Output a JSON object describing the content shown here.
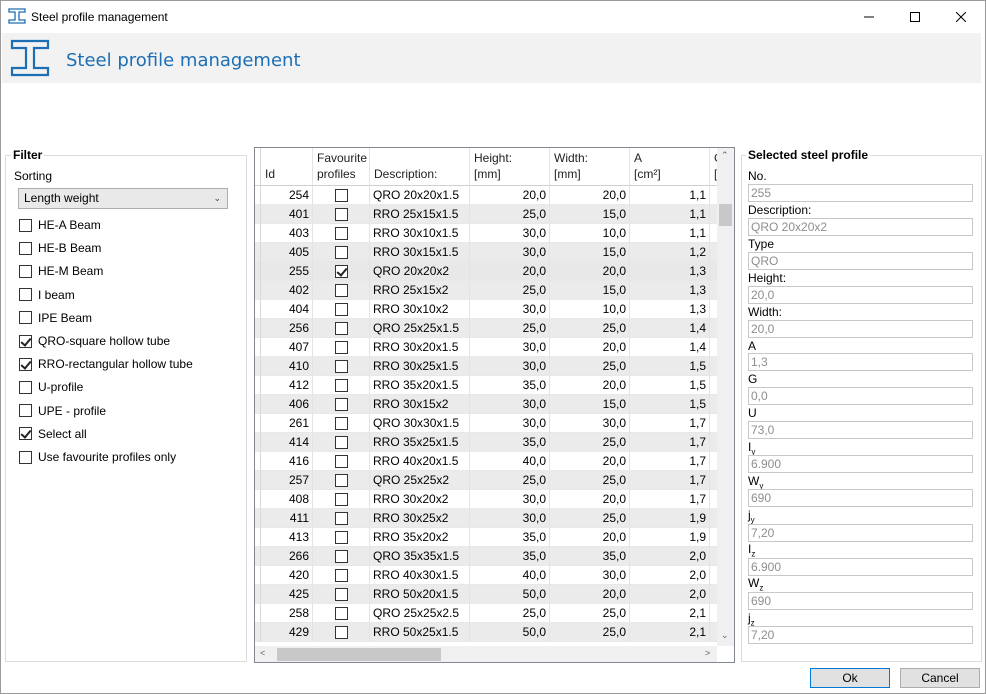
{
  "window": {
    "title": "Steel profile management"
  },
  "header": {
    "title": "Steel profile management"
  },
  "filter": {
    "group_title": "Filter",
    "sorting_label": "Sorting",
    "sorting_value": "Length weight",
    "options": [
      {
        "label": "HE-A Beam",
        "checked": false
      },
      {
        "label": "HE-B Beam",
        "checked": false
      },
      {
        "label": "HE-M Beam",
        "checked": false
      },
      {
        "label": "I beam",
        "checked": false
      },
      {
        "label": "IPE Beam",
        "checked": false
      },
      {
        "label": "QRO-square hollow tube",
        "checked": true
      },
      {
        "label": "RRO-rectangular hollow tube",
        "checked": true
      },
      {
        "label": "U-profile",
        "checked": false
      },
      {
        "label": "UPE - profile",
        "checked": false
      },
      {
        "label": "Select all",
        "checked": true
      },
      {
        "label": "Use favourite profiles only",
        "checked": false
      }
    ]
  },
  "grid": {
    "headers": {
      "id": "Id",
      "fav": "Favourite\nprofiles",
      "desc": "Description:",
      "height": "Height:\n[mm]",
      "width": "Width:\n[mm]",
      "a": "A\n[cm²]",
      "g": "G\n["
    },
    "rows": [
      {
        "id": "254",
        "fav": false,
        "desc": "QRO 20x20x1.5",
        "h": "20,0",
        "w": "20,0",
        "a": "1,1"
      },
      {
        "id": "401",
        "fav": false,
        "desc": "RRO 25x15x1.5",
        "h": "25,0",
        "w": "15,0",
        "a": "1,1"
      },
      {
        "id": "403",
        "fav": false,
        "desc": "RRO 30x10x1.5",
        "h": "30,0",
        "w": "10,0",
        "a": "1,1"
      },
      {
        "id": "405",
        "fav": false,
        "desc": "RRO 30x15x1.5",
        "h": "30,0",
        "w": "15,0",
        "a": "1,2"
      },
      {
        "id": "255",
        "fav": true,
        "desc": "QRO 20x20x2",
        "h": "20,0",
        "w": "20,0",
        "a": "1,3"
      },
      {
        "id": "402",
        "fav": false,
        "desc": "RRO 25x15x2",
        "h": "25,0",
        "w": "15,0",
        "a": "1,3"
      },
      {
        "id": "404",
        "fav": false,
        "desc": "RRO 30x10x2",
        "h": "30,0",
        "w": "10,0",
        "a": "1,3"
      },
      {
        "id": "256",
        "fav": false,
        "desc": "QRO 25x25x1.5",
        "h": "25,0",
        "w": "25,0",
        "a": "1,4"
      },
      {
        "id": "407",
        "fav": false,
        "desc": "RRO 30x20x1.5",
        "h": "30,0",
        "w": "20,0",
        "a": "1,4"
      },
      {
        "id": "410",
        "fav": false,
        "desc": "RRO 30x25x1.5",
        "h": "30,0",
        "w": "25,0",
        "a": "1,5"
      },
      {
        "id": "412",
        "fav": false,
        "desc": "RRO 35x20x1.5",
        "h": "35,0",
        "w": "20,0",
        "a": "1,5"
      },
      {
        "id": "406",
        "fav": false,
        "desc": "RRO 30x15x2",
        "h": "30,0",
        "w": "15,0",
        "a": "1,5"
      },
      {
        "id": "261",
        "fav": false,
        "desc": "QRO 30x30x1.5",
        "h": "30,0",
        "w": "30,0",
        "a": "1,7"
      },
      {
        "id": "414",
        "fav": false,
        "desc": "RRO 35x25x1.5",
        "h": "35,0",
        "w": "25,0",
        "a": "1,7"
      },
      {
        "id": "416",
        "fav": false,
        "desc": "RRO 40x20x1.5",
        "h": "40,0",
        "w": "20,0",
        "a": "1,7"
      },
      {
        "id": "257",
        "fav": false,
        "desc": "QRO 25x25x2",
        "h": "25,0",
        "w": "25,0",
        "a": "1,7"
      },
      {
        "id": "408",
        "fav": false,
        "desc": "RRO 30x20x2",
        "h": "30,0",
        "w": "20,0",
        "a": "1,7"
      },
      {
        "id": "411",
        "fav": false,
        "desc": "RRO 30x25x2",
        "h": "30,0",
        "w": "25,0",
        "a": "1,9"
      },
      {
        "id": "413",
        "fav": false,
        "desc": "RRO 35x20x2",
        "h": "35,0",
        "w": "20,0",
        "a": "1,9"
      },
      {
        "id": "266",
        "fav": false,
        "desc": "QRO 35x35x1.5",
        "h": "35,0",
        "w": "35,0",
        "a": "2,0"
      },
      {
        "id": "420",
        "fav": false,
        "desc": "RRO 40x30x1.5",
        "h": "40,0",
        "w": "30,0",
        "a": "2,0"
      },
      {
        "id": "425",
        "fav": false,
        "desc": "RRO 50x20x1.5",
        "h": "50,0",
        "w": "20,0",
        "a": "2,0"
      },
      {
        "id": "258",
        "fav": false,
        "desc": "QRO 25x25x2.5",
        "h": "25,0",
        "w": "25,0",
        "a": "2,1"
      },
      {
        "id": "429",
        "fav": false,
        "desc": "RRO 50x25x1.5",
        "h": "50,0",
        "w": "25,0",
        "a": "2,1"
      }
    ]
  },
  "selected": {
    "group_title": "Selected steel profile",
    "no_label": "No.",
    "no_value": "255",
    "desc_label": "Description:",
    "desc_value": "QRO 20x20x2",
    "type_label": "Type",
    "type_value": "QRO",
    "height_label": "Height:",
    "height_value": "20,0",
    "width_label": "Width:",
    "width_value": "20,0",
    "a_label": "A",
    "a_value": "1,3",
    "g_label": "G",
    "g_value": "0,0",
    "u_label": "U",
    "u_value": "73,0",
    "iy_label": "I",
    "iy_sub": "y",
    "iy_value": "6.900",
    "wy_label": "W",
    "wy_sub": "y",
    "wy_value": "690",
    "jy_label": "j",
    "jy_sub": "y",
    "jy_value": "7,20",
    "iz_label": "I",
    "iz_sub": "z",
    "iz_value": "6.900",
    "wz_label": "W",
    "wz_sub": "z",
    "wz_value": "690",
    "jz_label": "j",
    "jz_sub": "z",
    "jz_value": "7,20"
  },
  "buttons": {
    "ok": "Ok",
    "cancel": "Cancel"
  },
  "colors": {
    "accent": "#1c6fb4",
    "header_bg": "#f2f2f2",
    "row_alt": "#ebebeb"
  }
}
